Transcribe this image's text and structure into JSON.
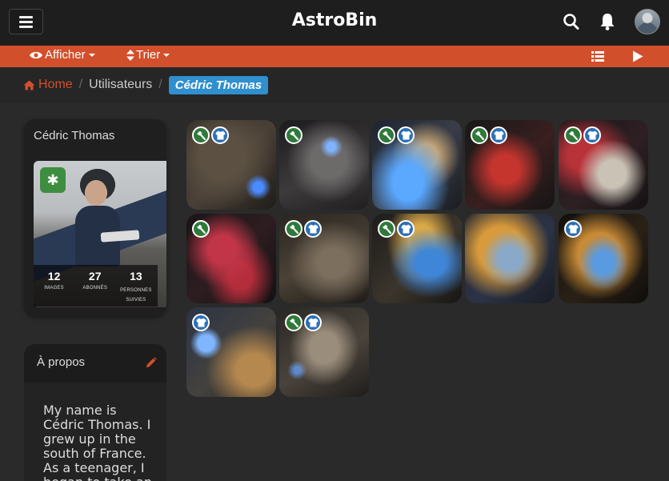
{
  "app": {
    "title": "AstroBin"
  },
  "navbar": {
    "menu_icon": "hamburger-icon",
    "search_icon": "search-icon",
    "bell_icon": "bell-icon",
    "avatar": "user-avatar"
  },
  "subnav": {
    "display_label": "Afficher",
    "sort_label": "Trier",
    "list_view_icon": "list-icon",
    "slideshow_icon": "play-icon"
  },
  "breadcrumb": {
    "home": "Home",
    "users": "Utilisateurs",
    "current": "Cédric Thomas"
  },
  "profile": {
    "name": "Cédric Thomas",
    "stats": [
      {
        "value": "12",
        "label": "IMAGES"
      },
      {
        "value": "27",
        "label": "ABONNÉS"
      },
      {
        "value": "13",
        "label": "PERSONNES SUIVIES"
      }
    ]
  },
  "about": {
    "title": "À propos",
    "text": "My name is Cédric Thomas. I grew up in the south of France. As a teenager, I began to take an"
  },
  "gallery": {
    "images": [
      {
        "badges": [
          "hammer",
          "tshirt"
        ]
      },
      {
        "badges": [
          "hammer"
        ]
      },
      {
        "badges": [
          "hammer",
          "tshirt"
        ]
      },
      {
        "badges": [
          "hammer",
          "tshirt"
        ]
      },
      {
        "badges": [
          "hammer",
          "tshirt"
        ]
      },
      {
        "badges": [
          "hammer"
        ]
      },
      {
        "badges": [
          "hammer",
          "tshirt"
        ]
      },
      {
        "badges": [
          "hammer",
          "tshirt"
        ]
      },
      {
        "badges": []
      },
      {
        "badges": [
          "tshirt"
        ]
      },
      {
        "badges": [
          "tshirt"
        ]
      },
      {
        "badges": [
          "hammer",
          "tshirt"
        ]
      }
    ]
  },
  "colors": {
    "accent": "#d24f2c",
    "active_crumb": "#2f8fcf",
    "badge_green": "#2f7a3a",
    "badge_blue": "#2d6fb6"
  }
}
